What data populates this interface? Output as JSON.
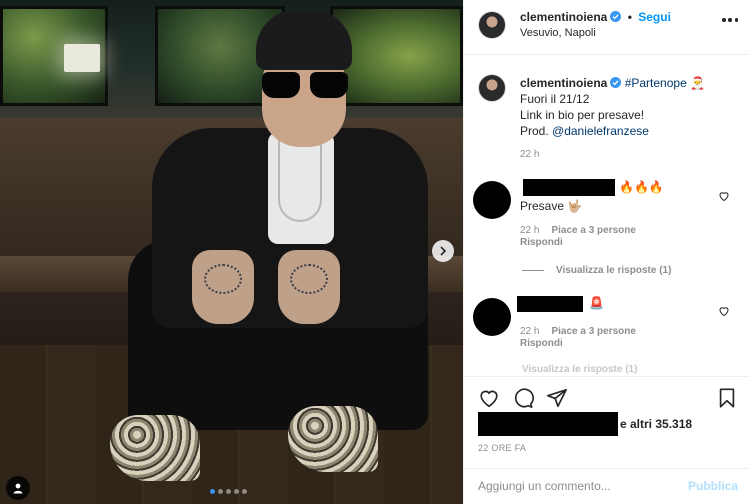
{
  "header": {
    "username": "clementinoiena",
    "separator": "•",
    "follow_label": "Segui",
    "location": "Vesuvio, Napoli"
  },
  "caption": {
    "username": "clementinoiena",
    "hashtag": "#Partenope",
    "emoji": "🎅",
    "line1": "Fuori il 21/12",
    "line2": "Link in bio per presave!",
    "prod_prefix": "Prod.",
    "prod_mention": "@danielefranzese",
    "time": "22 h"
  },
  "comments": [
    {
      "emoji": "🔥🔥🔥",
      "text": "Presave 🤟🏼",
      "time": "22 h",
      "likes": "Piace a 3 persone",
      "reply": "Rispondi",
      "view_replies": "Visualizza le risposte (1)"
    },
    {
      "emoji": "🚨",
      "time": "22 h",
      "likes": "Piace a 3 persone",
      "reply": "Rispondi",
      "view_replies": "Visualizza le risposte (1)"
    }
  ],
  "likes": {
    "text": "e altri 35.318"
  },
  "post_time": "22 ORE FA",
  "comment_box": {
    "placeholder": "Aggiungi un commento...",
    "post_label": "Pubblica"
  },
  "carousel": {
    "count": 5,
    "active_index": 0
  },
  "colors": {
    "accent": "#0095f6",
    "text": "#262626",
    "muted": "#8e8e8e",
    "post_disabled": "#b2dffc"
  }
}
